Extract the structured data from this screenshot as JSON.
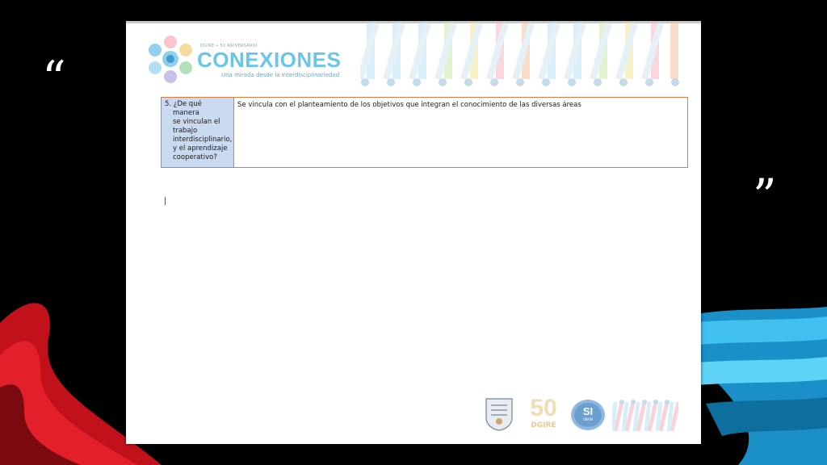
{
  "quotes": {
    "open": "“",
    "close": "”"
  },
  "header": {
    "small_text": "DGIRE • 50 ANIVERSARIO",
    "title": "CONEXIONES",
    "subtitle": "Una mirada desde la interdisciplinariedad"
  },
  "table": {
    "question_lines": [
      "5. ¿De qué",
      "manera",
      "se vinculan el",
      "trabajo",
      "interdisciplinario,",
      "y el aprendizaje",
      "cooperativo?"
    ],
    "answer": "Se vincula con el planteamiento de los objetivos que integran el conocimiento de las diversas áreas"
  },
  "footer": {
    "anniversary_number": "50",
    "anniversary_label": "DGIRE",
    "si_label": "SI",
    "si_sub": "UNAM"
  },
  "colors": {
    "background": "#000000",
    "slide": "#ffffff",
    "question_cell": "#c9d9ef",
    "table_border": "#e07a45",
    "brand": "#6ac6e6"
  }
}
